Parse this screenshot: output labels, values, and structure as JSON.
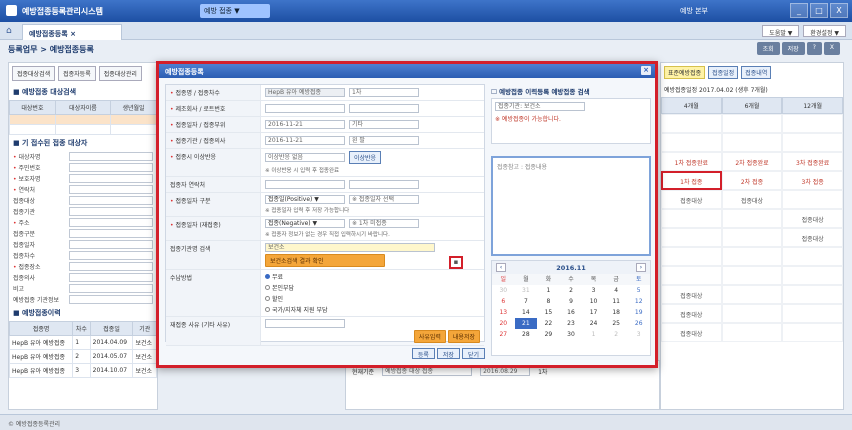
{
  "titlebar": {
    "app_title": "예방접종등록관리시스템",
    "user_select": "예방 접종 ▼",
    "right_info": "예방 본부",
    "window_controls": [
      "_",
      "□",
      "X"
    ]
  },
  "tabbar": {
    "active_tab": "예방접종등록 ×",
    "right_buttons": [
      "도움말 ▼",
      "환경설정 ▼"
    ]
  },
  "page": {
    "breadcrumb": "등록업무 > 예방접종등록",
    "header_buttons": [
      "조회",
      "저장",
      "?",
      "X"
    ]
  },
  "left_panel": {
    "top_buttons": [
      "접종대상검색",
      "접종자등록",
      "접종대상관리"
    ],
    "section1_title": "■ 예방접종 대상검색",
    "table1_headers": [
      "대상번호",
      "대상자이름",
      "생년월일"
    ],
    "section2_title": "■ 기 접수된 접종 대상자",
    "fields": [
      {
        "label": "대상자명",
        "req": true
      },
      {
        "label": "주민번호",
        "req": true
      },
      {
        "label": "보호자명",
        "req": true
      },
      {
        "label": "연락처",
        "req": true
      },
      {
        "label": "접종대상",
        "req": false
      },
      {
        "label": "접종기관",
        "req": false
      },
      {
        "label": "주소",
        "req": true
      },
      {
        "label": "접종구분",
        "req": false
      },
      {
        "label": "접종일자",
        "req": false
      },
      {
        "label": "접종차수",
        "req": false
      },
      {
        "label": "접종장소",
        "req": true
      },
      {
        "label": "접종의사",
        "req": false
      },
      {
        "label": "비고",
        "req": false
      },
      {
        "label": "예방접종 기관정보",
        "req": false
      }
    ],
    "section3_title": "■ 예방접종이력",
    "table2_headers": [
      "접종명",
      "차수",
      "접종일",
      "기관"
    ],
    "table2_rows": [
      [
        "HepB 유아 예방접종",
        "1",
        "2014.04.09",
        "보건소"
      ],
      [
        "HepB 유아 예방접종",
        "2",
        "2014.05.07",
        "보건소"
      ],
      [
        "HepB 유아 예방접종",
        "3",
        "2014.10.07",
        "보건소"
      ]
    ]
  },
  "right_panel": {
    "top_items": [
      "표준예방접종",
      "접종일정",
      "접종내역"
    ],
    "sub_info": "예방접종일정 2017.04.02 (생후 7개월)",
    "cal_headers": [
      "4개월",
      "6개월",
      "12개월"
    ],
    "rows": [
      [
        "",
        "",
        ""
      ],
      [
        "",
        "",
        ""
      ],
      [
        "1차 접종완료",
        "2차 접종완료",
        "3차 접종완료"
      ],
      [
        "1차 접종",
        "2차 접종",
        "3차 접종"
      ],
      [
        "접종대상",
        "접종대상",
        ""
      ],
      [
        "",
        "",
        "접종대상"
      ],
      [
        "",
        "",
        "접종대상"
      ],
      [
        "",
        "",
        ""
      ],
      [
        "",
        "",
        ""
      ],
      [
        "접종대상",
        "",
        ""
      ],
      [
        "접종대상",
        "",
        ""
      ],
      [
        "접종대상",
        "",
        ""
      ]
    ],
    "boxed_cell": "1차 접종"
  },
  "mid_panel": {
    "label": "현재기준",
    "items": [
      "예방접종 대상 접종",
      "2016.08.29",
      "1차"
    ]
  },
  "status": "© 예방접종등록관리",
  "modal": {
    "title": "예방접종등록",
    "rows": [
      {
        "label": "접종명 / 접종차수",
        "req": true,
        "values": [
          "HepB 유아 예방접종",
          "1차"
        ]
      },
      {
        "label": "제조회사 / 로트번호",
        "req": true,
        "values": [
          "",
          ""
        ]
      },
      {
        "label": "접종일자 / 접종부위",
        "req": true,
        "values": [
          "2016-11-21",
          "기타"
        ]
      },
      {
        "label": "접종기관 / 접종의사",
        "req": true,
        "values": [
          "2016-11-21",
          "왼 팔"
        ]
      },
      {
        "label": "접종시 이상반응",
        "req": true,
        "values": [
          "이상반응 없음"
        ],
        "note": "※ 이상반응 시 입력 후 접종완료",
        "button": "이상반응"
      },
      {
        "label": "접종자 연락처",
        "req": false,
        "values": [
          "",
          ""
        ]
      },
      {
        "label": "접종일자 구분",
        "req": true,
        "values": [
          "접종일(Positive) ▼",
          "※ 접종일자 선택"
        ],
        "note": "※ 접종일자 입력 후 저장 가능합니다"
      },
      {
        "label": "접종일자 (재접종)",
        "req": true,
        "values": [
          "접종(Negative) ▼",
          "※ 1차 미접종"
        ],
        "note": "※ 접종자 정보가 없는 경우 직접 입력하시기 바랍니다."
      },
      {
        "label": "접종기관명 검색",
        "req": false,
        "values": [
          "보건소"
        ],
        "button": "보건소검색 결과 확인"
      },
      {
        "label": "수납방법",
        "req": false,
        "radios": [
          "무료",
          "본인부담",
          "할인",
          "국가/지자체 지원 부담"
        ]
      },
      {
        "label": "재접종 사유 (기타 사유)",
        "req": false,
        "values": [
          ""
        ],
        "buttons": [
          "사유입력",
          "내용저장"
        ]
      }
    ],
    "right_title": "☐ 예방접종 이력등록 예방접종 검색",
    "info_lines": [
      "접종기관: 보건소",
      "※ 예방접종이 가능합니다."
    ],
    "memo_placeholder": "접종참고 : 접종내용",
    "calendar": {
      "month": "2016.11",
      "dow": [
        "일",
        "월",
        "화",
        "수",
        "목",
        "금",
        "토"
      ],
      "days": [
        [
          "30",
          "31",
          "1",
          "2",
          "3",
          "4",
          "5"
        ],
        [
          "6",
          "7",
          "8",
          "9",
          "10",
          "11",
          "12"
        ],
        [
          "13",
          "14",
          "15",
          "16",
          "17",
          "18",
          "19"
        ],
        [
          "20",
          "21",
          "22",
          "23",
          "24",
          "25",
          "26"
        ],
        [
          "27",
          "28",
          "29",
          "30",
          "1",
          "2",
          "3"
        ]
      ],
      "selected": "21"
    },
    "footer_buttons": [
      "등록",
      "저장",
      "닫기"
    ]
  }
}
